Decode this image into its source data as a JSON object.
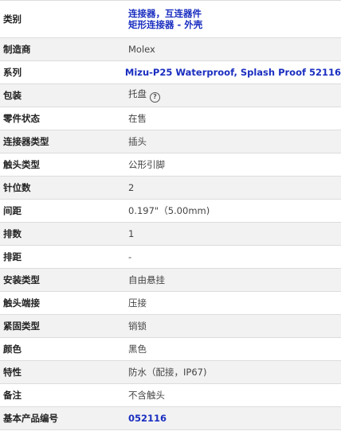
{
  "specs": {
    "category": {
      "label": "类别",
      "links": [
        "连接器，互连器件",
        "矩形连接器 - 外壳"
      ]
    },
    "manufacturer": {
      "label": "制造商",
      "value": "Molex"
    },
    "series": {
      "label": "系列",
      "value": "Mizu-P25 Waterproof, Splash Proof 52116"
    },
    "packaging": {
      "label": "包装",
      "value": "托盘",
      "icon": "help-circle-icon"
    },
    "part_status": {
      "label": "零件状态",
      "value": "在售"
    },
    "connector_type": {
      "label": "连接器类型",
      "value": "插头"
    },
    "contact_type": {
      "label": "触头类型",
      "value": "公形引脚"
    },
    "positions": {
      "label": "针位数",
      "value": "2"
    },
    "pitch": {
      "label": "间距",
      "value": "0.197\"（5.00mm)"
    },
    "rows": {
      "label": "排数",
      "value": "1"
    },
    "row_spacing": {
      "label": "排距",
      "value": "-"
    },
    "mounting_type": {
      "label": "安装类型",
      "value": "自由悬挂"
    },
    "contact_termination": {
      "label": "触头端接",
      "value": "压接"
    },
    "fastening_type": {
      "label": "紧固类型",
      "value": "销锁"
    },
    "color": {
      "label": "颜色",
      "value": "黑色"
    },
    "features": {
      "label": "特性",
      "value": "防水（配接，IP67)"
    },
    "note": {
      "label": "备注",
      "value": "不含触头"
    },
    "base_product_number": {
      "label": "基本产品编号",
      "value": "052116"
    }
  }
}
